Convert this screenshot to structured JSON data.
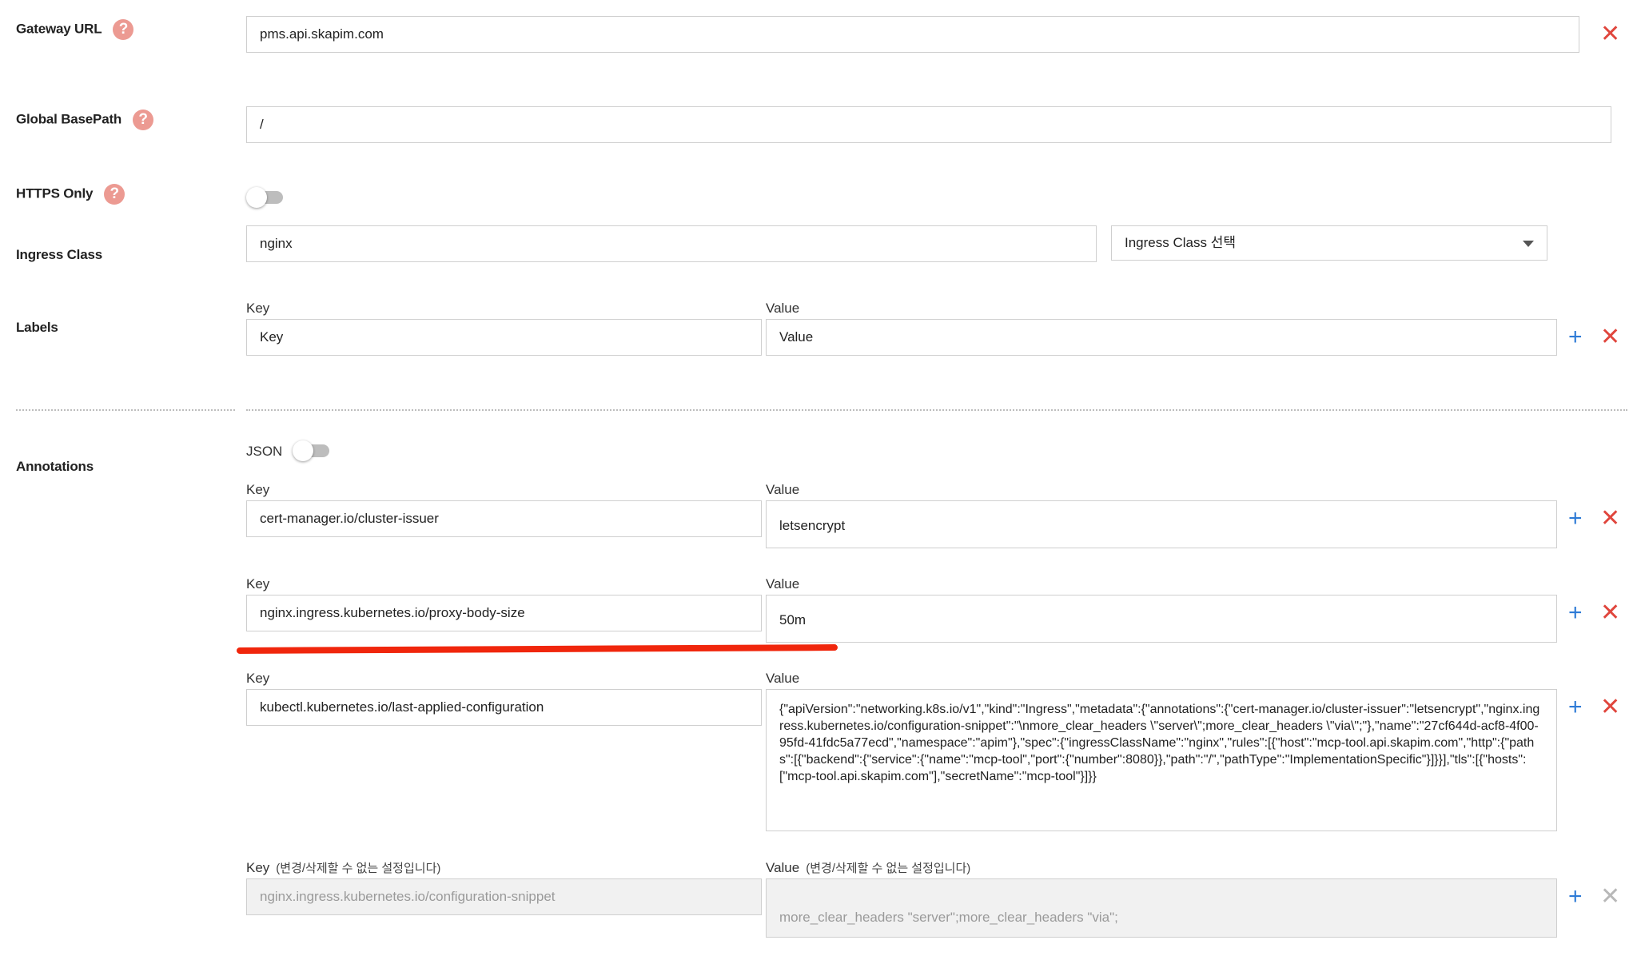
{
  "gateway": {
    "label": "Gateway URL",
    "help": "?",
    "value": "pms.api.skapim.com"
  },
  "basepath": {
    "label": "Global BasePath",
    "help": "?",
    "value": "/"
  },
  "https": {
    "label": "HTTPS Only",
    "help": "?",
    "enabled": false
  },
  "ingress": {
    "label": "Ingress Class",
    "value": "nginx",
    "select_placeholder": "Ingress Class 선택"
  },
  "labels": {
    "label": "Labels",
    "key_header": "Key",
    "value_header": "Value",
    "key_placeholder": "Key",
    "value_placeholder": "Value"
  },
  "annotations": {
    "label": "Annotations",
    "json_label": "JSON",
    "json_enabled": false,
    "items": [
      {
        "key_header": "Key",
        "value_header": "Value",
        "key": "cert-manager.io/cluster-issuer",
        "value": "letsencrypt"
      },
      {
        "key_header": "Key",
        "value_header": "Value",
        "key": "nginx.ingress.kubernetes.io/proxy-body-size",
        "value": "50m"
      },
      {
        "key_header": "Key",
        "value_header": "Value",
        "key": "kubectl.kubernetes.io/last-applied-configuration",
        "value": "{\"apiVersion\":\"networking.k8s.io/v1\",\"kind\":\"Ingress\",\"metadata\":{\"annotations\":{\"cert-manager.io/cluster-issuer\":\"letsencrypt\",\"nginx.ingress.kubernetes.io/configuration-snippet\":\"\\nmore_clear_headers \\\"server\\\";more_clear_headers \\\"via\\\";\"},\"name\":\"27cf644d-acf8-4f00-95fd-41fdc5a77ecd\",\"namespace\":\"apim\"},\"spec\":{\"ingressClassName\":\"nginx\",\"rules\":[{\"host\":\"mcp-tool.api.skapim.com\",\"http\":{\"paths\":[{\"backend\":{\"service\":{\"name\":\"mcp-tool\",\"port\":{\"number\":8080}},\"path\":\"/\",\"pathType\":\"ImplementationSpecific\"}]}}],\"tls\":[{\"hosts\":[\"mcp-tool.api.skapim.com\"],\"secretName\":\"mcp-tool\"}]}}"
      },
      {
        "key_header": "Key",
        "value_header": "Value",
        "locked_note": "(변경/삭제할 수 없는 설정입니다)",
        "key": "nginx.ingress.kubernetes.io/configuration-snippet",
        "value": "more_clear_headers \"server\";more_clear_headers \"via\";"
      }
    ]
  },
  "icons": {
    "add": "+",
    "remove": "✕"
  },
  "colors": {
    "help": "#ec9a92",
    "add": "#2f7bd6",
    "remove": "#e0463d",
    "highlight": "#f0260c"
  }
}
